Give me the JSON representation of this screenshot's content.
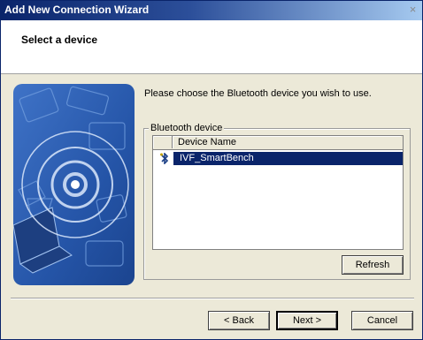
{
  "window": {
    "title": "Add New Connection Wizard",
    "close_glyph": "×"
  },
  "header": {
    "title": "Select a device"
  },
  "main": {
    "instruction": "Please choose the Bluetooth device you wish to use.",
    "group_label": "Bluetooth device",
    "list": {
      "columns": [
        "",
        "Device Name"
      ],
      "rows": [
        {
          "icon": "bluetooth-device-icon",
          "name": "IVF_SmartBench",
          "selected": true
        }
      ]
    },
    "refresh_label": "Refresh"
  },
  "footer": {
    "back_label": "< Back",
    "next_label": "Next >",
    "cancel_label": "Cancel"
  },
  "colors": {
    "title_bar": "#0a246a",
    "selection": "#0a246a",
    "dialog_bg": "#ece9d8",
    "art_blue": "#2a5cb0"
  }
}
